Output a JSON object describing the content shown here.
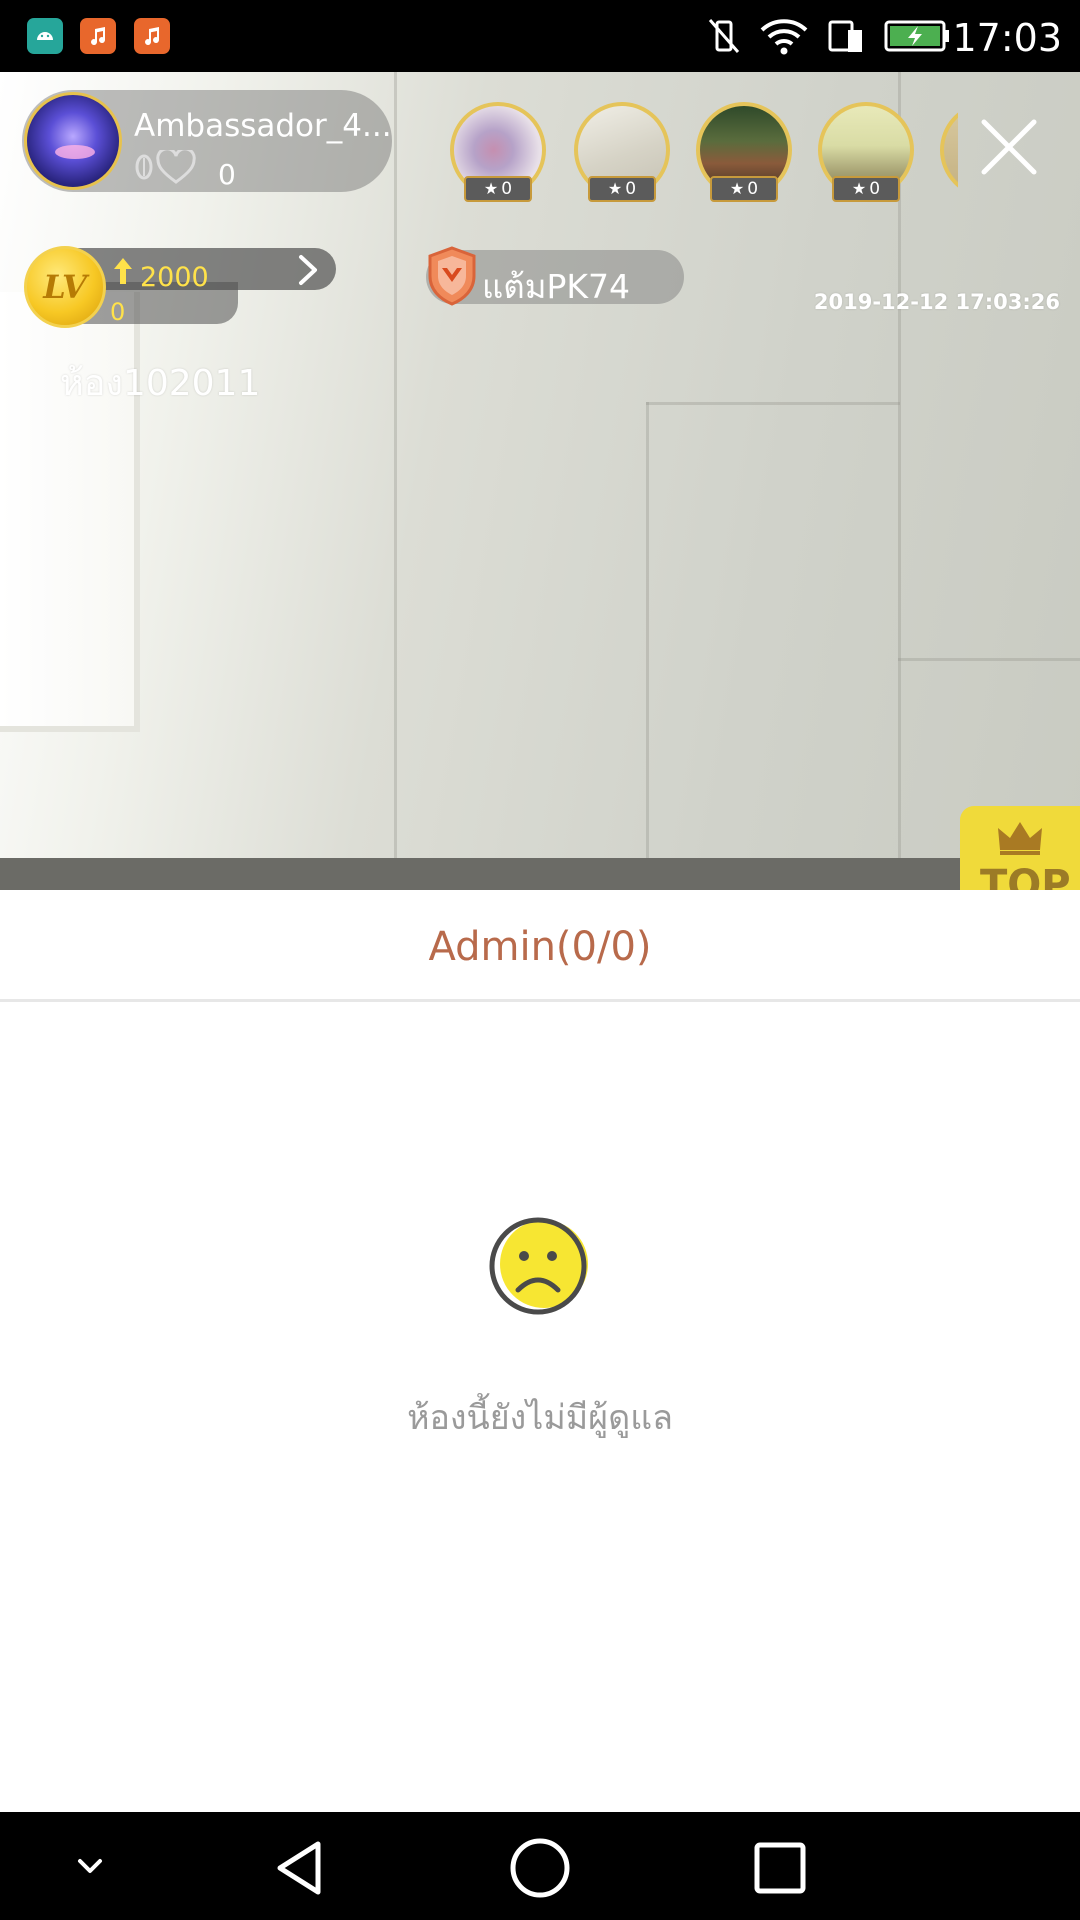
{
  "status_bar": {
    "time": "17:03",
    "left_icons": [
      "android-app-icon",
      "music-app-icon",
      "music-app-icon"
    ],
    "right_icons": [
      "vibrate-off-icon",
      "wifi-icon",
      "data-transfer-icon",
      "battery-charging-icon"
    ],
    "colors": {
      "background": "#000000",
      "battery": "#4caf50"
    }
  },
  "live_room": {
    "host": {
      "name": "Ambassador_4...",
      "count": "0"
    },
    "viewers": [
      {
        "badge": "0"
      },
      {
        "badge": "0"
      },
      {
        "badge": "0"
      },
      {
        "badge": "0"
      }
    ],
    "level": {
      "badge": "LV",
      "value": "2000",
      "sub": "0"
    },
    "pk": {
      "label": "แต้มPK74"
    },
    "timestamp": "2019-12-12 17:03:26",
    "room_id": "ห้อง102011",
    "top_button": "TOP"
  },
  "admin_panel": {
    "title": "Admin(0/0)",
    "empty_message": "ห้องนี้ยังไม่มีผู้ดูแล",
    "colors": {
      "title": "#b86a4b",
      "message": "#9a9a9a",
      "icon_fill": "#f7e632"
    }
  },
  "nav_bar": {
    "buttons": [
      "collapse-icon",
      "back-icon",
      "home-icon",
      "recents-icon"
    ]
  }
}
